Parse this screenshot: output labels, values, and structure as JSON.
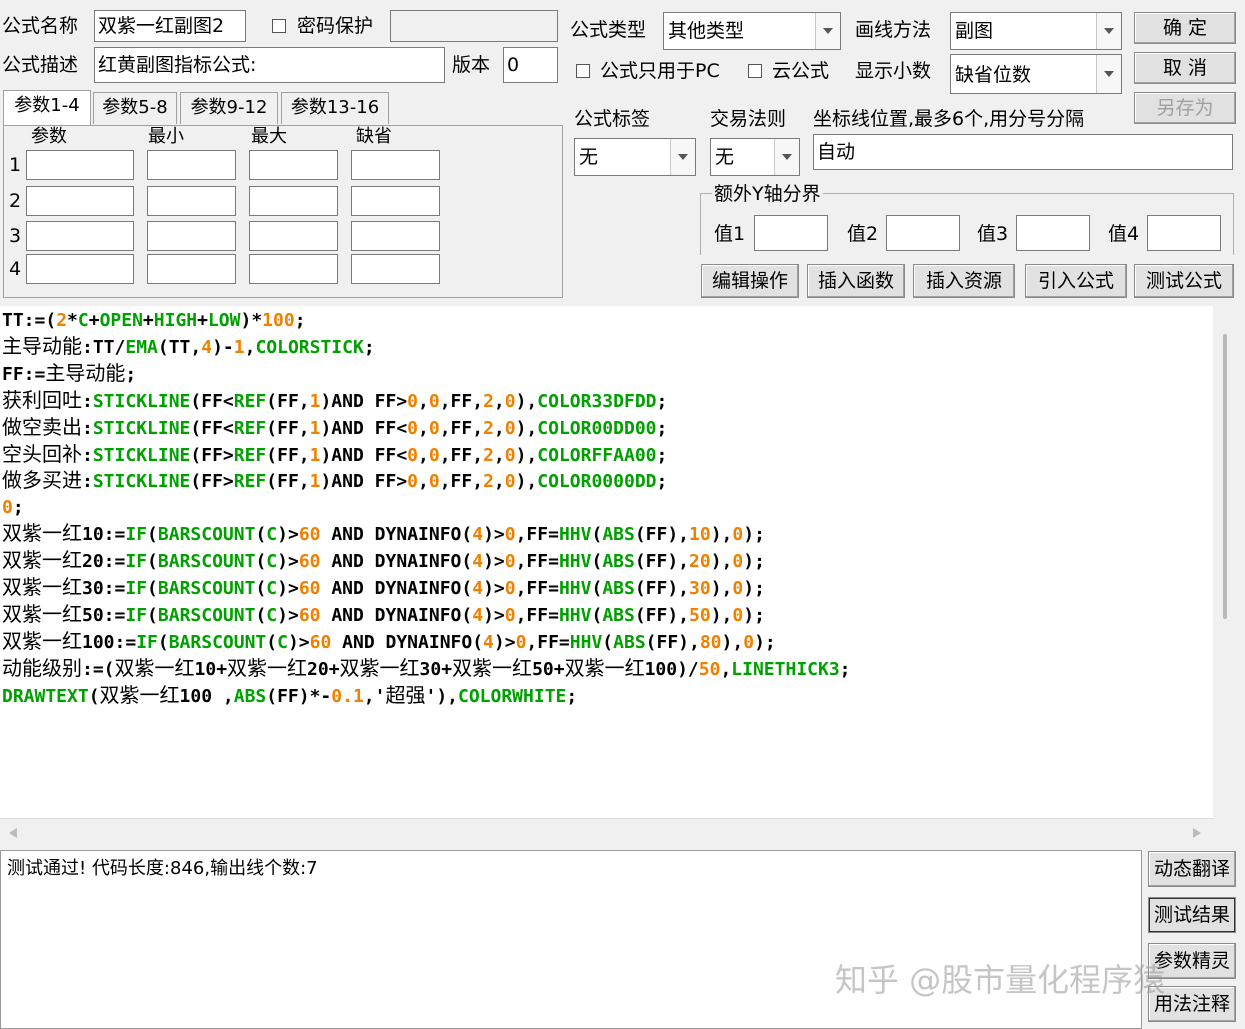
{
  "header": {
    "name_label": "公式名称",
    "name_value": "双紫一红副图2",
    "password_label": "密码保护",
    "desc_label": "公式描述",
    "desc_value": "红黄副图指标公式:",
    "version_label": "版本",
    "version_value": "0",
    "type_label": "公式类型",
    "type_value": "其他类型",
    "draw_label": "画线方法",
    "draw_value": "副图",
    "pc_only_label": "公式只用于PC",
    "cloud_label": "云公式",
    "decimals_label": "显示小数",
    "decimals_value": "缺省位数",
    "ok_button": "确  定",
    "cancel_button": "取  消",
    "saveas_button": "另存为"
  },
  "tabs": [
    "参数1-4",
    "参数5-8",
    "参数9-12",
    "参数13-16"
  ],
  "params": {
    "col_headers": [
      "参数",
      "最小",
      "最大",
      "缺省"
    ],
    "rows": [
      "1",
      "2",
      "3",
      "4"
    ]
  },
  "right_panel": {
    "tag_label": "公式标签",
    "tag_value": "无",
    "rule_label": "交易法则",
    "rule_value": "无",
    "axis_label": "坐标线位置,最多6个,用分号分隔",
    "axis_value": "自动",
    "extra_y_label": "额外Y轴分界",
    "values": [
      "值1",
      "值2",
      "值3",
      "值4"
    ]
  },
  "actions": [
    "编辑操作",
    "插入函数",
    "插入资源",
    "引入公式",
    "测试公式"
  ],
  "code_lines": [
    [
      [
        "n",
        "TT:=("
      ],
      [
        "o",
        "2"
      ],
      [
        "n",
        "*"
      ],
      [
        "f",
        "C"
      ],
      [
        "n",
        "+"
      ],
      [
        "f",
        "OPEN"
      ],
      [
        "n",
        "+"
      ],
      [
        "f",
        "HIGH"
      ],
      [
        "n",
        "+"
      ],
      [
        "f",
        "LOW"
      ],
      [
        "n",
        ")*"
      ],
      [
        "o",
        "100"
      ],
      [
        "n",
        ";"
      ]
    ],
    [
      [
        "c",
        "主导动能"
      ],
      [
        "n",
        ":TT/"
      ],
      [
        "f",
        "EMA"
      ],
      [
        "n",
        "(TT,"
      ],
      [
        "o",
        "4"
      ],
      [
        "n",
        ")-"
      ],
      [
        "o",
        "1"
      ],
      [
        "n",
        ","
      ],
      [
        "f",
        "COLORSTICK"
      ],
      [
        "n",
        ";"
      ]
    ],
    [
      [
        "n",
        "FF:="
      ],
      [
        "c",
        "主导动能"
      ],
      [
        "n",
        ";"
      ]
    ],
    [
      [
        "c",
        "获利回吐"
      ],
      [
        "n",
        ":"
      ],
      [
        "f",
        "STICKLINE"
      ],
      [
        "n",
        "(FF<"
      ],
      [
        "f",
        "REF"
      ],
      [
        "n",
        "(FF,"
      ],
      [
        "o",
        "1"
      ],
      [
        "n",
        ")AND FF>"
      ],
      [
        "o",
        "0"
      ],
      [
        "n",
        ","
      ],
      [
        "o",
        "0"
      ],
      [
        "n",
        ",FF,"
      ],
      [
        "o",
        "2"
      ],
      [
        "n",
        ","
      ],
      [
        "o",
        "0"
      ],
      [
        "n",
        "),"
      ],
      [
        "f",
        "COLOR33DFDD"
      ],
      [
        "n",
        ";"
      ]
    ],
    [
      [
        "c",
        "做空卖出"
      ],
      [
        "n",
        ":"
      ],
      [
        "f",
        "STICKLINE"
      ],
      [
        "n",
        "(FF<"
      ],
      [
        "f",
        "REF"
      ],
      [
        "n",
        "(FF,"
      ],
      [
        "o",
        "1"
      ],
      [
        "n",
        ")AND FF<"
      ],
      [
        "o",
        "0"
      ],
      [
        "n",
        ","
      ],
      [
        "o",
        "0"
      ],
      [
        "n",
        ",FF,"
      ],
      [
        "o",
        "2"
      ],
      [
        "n",
        ","
      ],
      [
        "o",
        "0"
      ],
      [
        "n",
        "),"
      ],
      [
        "f",
        "COLOR00DD00"
      ],
      [
        "n",
        ";"
      ]
    ],
    [
      [
        "c",
        "空头回补"
      ],
      [
        "n",
        ":"
      ],
      [
        "f",
        "STICKLINE"
      ],
      [
        "n",
        "(FF>"
      ],
      [
        "f",
        "REF"
      ],
      [
        "n",
        "(FF,"
      ],
      [
        "o",
        "1"
      ],
      [
        "n",
        ")AND FF<"
      ],
      [
        "o",
        "0"
      ],
      [
        "n",
        ","
      ],
      [
        "o",
        "0"
      ],
      [
        "n",
        ",FF,"
      ],
      [
        "o",
        "2"
      ],
      [
        "n",
        ","
      ],
      [
        "o",
        "0"
      ],
      [
        "n",
        "),"
      ],
      [
        "f",
        "COLORFFAA00"
      ],
      [
        "n",
        ";"
      ]
    ],
    [
      [
        "c",
        "做多买进"
      ],
      [
        "n",
        ":"
      ],
      [
        "f",
        "STICKLINE"
      ],
      [
        "n",
        "(FF>"
      ],
      [
        "f",
        "REF"
      ],
      [
        "n",
        "(FF,"
      ],
      [
        "o",
        "1"
      ],
      [
        "n",
        ")AND FF>"
      ],
      [
        "o",
        "0"
      ],
      [
        "n",
        ","
      ],
      [
        "o",
        "0"
      ],
      [
        "n",
        ",FF,"
      ],
      [
        "o",
        "2"
      ],
      [
        "n",
        ","
      ],
      [
        "o",
        "0"
      ],
      [
        "n",
        "),"
      ],
      [
        "f",
        "COLOR0000DD"
      ],
      [
        "n",
        ";"
      ]
    ],
    [
      [
        "o",
        "0"
      ],
      [
        "n",
        ";"
      ]
    ],
    [
      [
        "c",
        "双紫一红"
      ],
      [
        "n",
        "10:="
      ],
      [
        "f",
        "IF"
      ],
      [
        "n",
        "("
      ],
      [
        "f",
        "BARSCOUNT"
      ],
      [
        "n",
        "("
      ],
      [
        "f",
        "C"
      ],
      [
        "n",
        ")>"
      ],
      [
        "o",
        "60"
      ],
      [
        "n",
        " AND DYNAINFO("
      ],
      [
        "o",
        "4"
      ],
      [
        "n",
        ")>"
      ],
      [
        "o",
        "0"
      ],
      [
        "n",
        ",FF="
      ],
      [
        "f",
        "HHV"
      ],
      [
        "n",
        "("
      ],
      [
        "f",
        "ABS"
      ],
      [
        "n",
        "(FF),"
      ],
      [
        "o",
        "10"
      ],
      [
        "n",
        "),"
      ],
      [
        "o",
        "0"
      ],
      [
        "n",
        ");"
      ]
    ],
    [
      [
        "c",
        "双紫一红"
      ],
      [
        "n",
        "20:="
      ],
      [
        "f",
        "IF"
      ],
      [
        "n",
        "("
      ],
      [
        "f",
        "BARSCOUNT"
      ],
      [
        "n",
        "("
      ],
      [
        "f",
        "C"
      ],
      [
        "n",
        ")>"
      ],
      [
        "o",
        "60"
      ],
      [
        "n",
        " AND DYNAINFO("
      ],
      [
        "o",
        "4"
      ],
      [
        "n",
        ")>"
      ],
      [
        "o",
        "0"
      ],
      [
        "n",
        ",FF="
      ],
      [
        "f",
        "HHV"
      ],
      [
        "n",
        "("
      ],
      [
        "f",
        "ABS"
      ],
      [
        "n",
        "(FF),"
      ],
      [
        "o",
        "20"
      ],
      [
        "n",
        "),"
      ],
      [
        "o",
        "0"
      ],
      [
        "n",
        ");"
      ]
    ],
    [
      [
        "c",
        "双紫一红"
      ],
      [
        "n",
        "30:="
      ],
      [
        "f",
        "IF"
      ],
      [
        "n",
        "("
      ],
      [
        "f",
        "BARSCOUNT"
      ],
      [
        "n",
        "("
      ],
      [
        "f",
        "C"
      ],
      [
        "n",
        ")>"
      ],
      [
        "o",
        "60"
      ],
      [
        "n",
        " AND DYNAINFO("
      ],
      [
        "o",
        "4"
      ],
      [
        "n",
        ")>"
      ],
      [
        "o",
        "0"
      ],
      [
        "n",
        ",FF="
      ],
      [
        "f",
        "HHV"
      ],
      [
        "n",
        "("
      ],
      [
        "f",
        "ABS"
      ],
      [
        "n",
        "(FF),"
      ],
      [
        "o",
        "30"
      ],
      [
        "n",
        "),"
      ],
      [
        "o",
        "0"
      ],
      [
        "n",
        ");"
      ]
    ],
    [
      [
        "c",
        "双紫一红"
      ],
      [
        "n",
        "50:="
      ],
      [
        "f",
        "IF"
      ],
      [
        "n",
        "("
      ],
      [
        "f",
        "BARSCOUNT"
      ],
      [
        "n",
        "("
      ],
      [
        "f",
        "C"
      ],
      [
        "n",
        ")>"
      ],
      [
        "o",
        "60"
      ],
      [
        "n",
        " AND DYNAINFO("
      ],
      [
        "o",
        "4"
      ],
      [
        "n",
        ")>"
      ],
      [
        "o",
        "0"
      ],
      [
        "n",
        ",FF="
      ],
      [
        "f",
        "HHV"
      ],
      [
        "n",
        "("
      ],
      [
        "f",
        "ABS"
      ],
      [
        "n",
        "(FF),"
      ],
      [
        "o",
        "50"
      ],
      [
        "n",
        "),"
      ],
      [
        "o",
        "0"
      ],
      [
        "n",
        ");"
      ]
    ],
    [
      [
        "c",
        "双紫一红"
      ],
      [
        "n",
        "100:="
      ],
      [
        "f",
        "IF"
      ],
      [
        "n",
        "("
      ],
      [
        "f",
        "BARSCOUNT"
      ],
      [
        "n",
        "("
      ],
      [
        "f",
        "C"
      ],
      [
        "n",
        ")>"
      ],
      [
        "o",
        "60"
      ],
      [
        "n",
        " AND DYNAINFO("
      ],
      [
        "o",
        "4"
      ],
      [
        "n",
        ")>"
      ],
      [
        "o",
        "0"
      ],
      [
        "n",
        ",FF="
      ],
      [
        "f",
        "HHV"
      ],
      [
        "n",
        "("
      ],
      [
        "f",
        "ABS"
      ],
      [
        "n",
        "(FF),"
      ],
      [
        "o",
        "80"
      ],
      [
        "n",
        "),"
      ],
      [
        "o",
        "0"
      ],
      [
        "n",
        ");"
      ]
    ],
    [
      [
        "c",
        "动能级别"
      ],
      [
        "n",
        ":=("
      ],
      [
        "c",
        "双紫一红"
      ],
      [
        "n",
        "10+"
      ],
      [
        "c",
        "双紫一红"
      ],
      [
        "n",
        "20+"
      ],
      [
        "c",
        "双紫一红"
      ],
      [
        "n",
        "30+"
      ],
      [
        "c",
        "双紫一红"
      ],
      [
        "n",
        "50+"
      ],
      [
        "c",
        "双紫一红"
      ],
      [
        "n",
        "100)/"
      ],
      [
        "o",
        "50"
      ],
      [
        "n",
        ","
      ],
      [
        "f",
        "LINETHICK3"
      ],
      [
        "n",
        ";"
      ]
    ],
    [
      [
        "f",
        "DRAWTEXT"
      ],
      [
        "n",
        "("
      ],
      [
        "c",
        "双紫一红"
      ],
      [
        "n",
        "100 ,"
      ],
      [
        "f",
        "ABS"
      ],
      [
        "n",
        "(FF)*-"
      ],
      [
        "o",
        "0.1"
      ],
      [
        "n",
        ",'"
      ],
      [
        "c",
        "超强"
      ],
      [
        "n",
        "'),"
      ],
      [
        "f",
        "COLORWHITE"
      ],
      [
        "n",
        ";"
      ]
    ]
  ],
  "colors": {
    "func": "#00a000",
    "number": "#f08000",
    "text": "#000000"
  },
  "output": {
    "text": "测试通过! 代码长度:846,输出线个数:7"
  },
  "side_buttons": [
    "动态翻译",
    "测试结果",
    "参数精灵",
    "用法注释"
  ],
  "watermark": "知乎 @股市量化程序猿"
}
